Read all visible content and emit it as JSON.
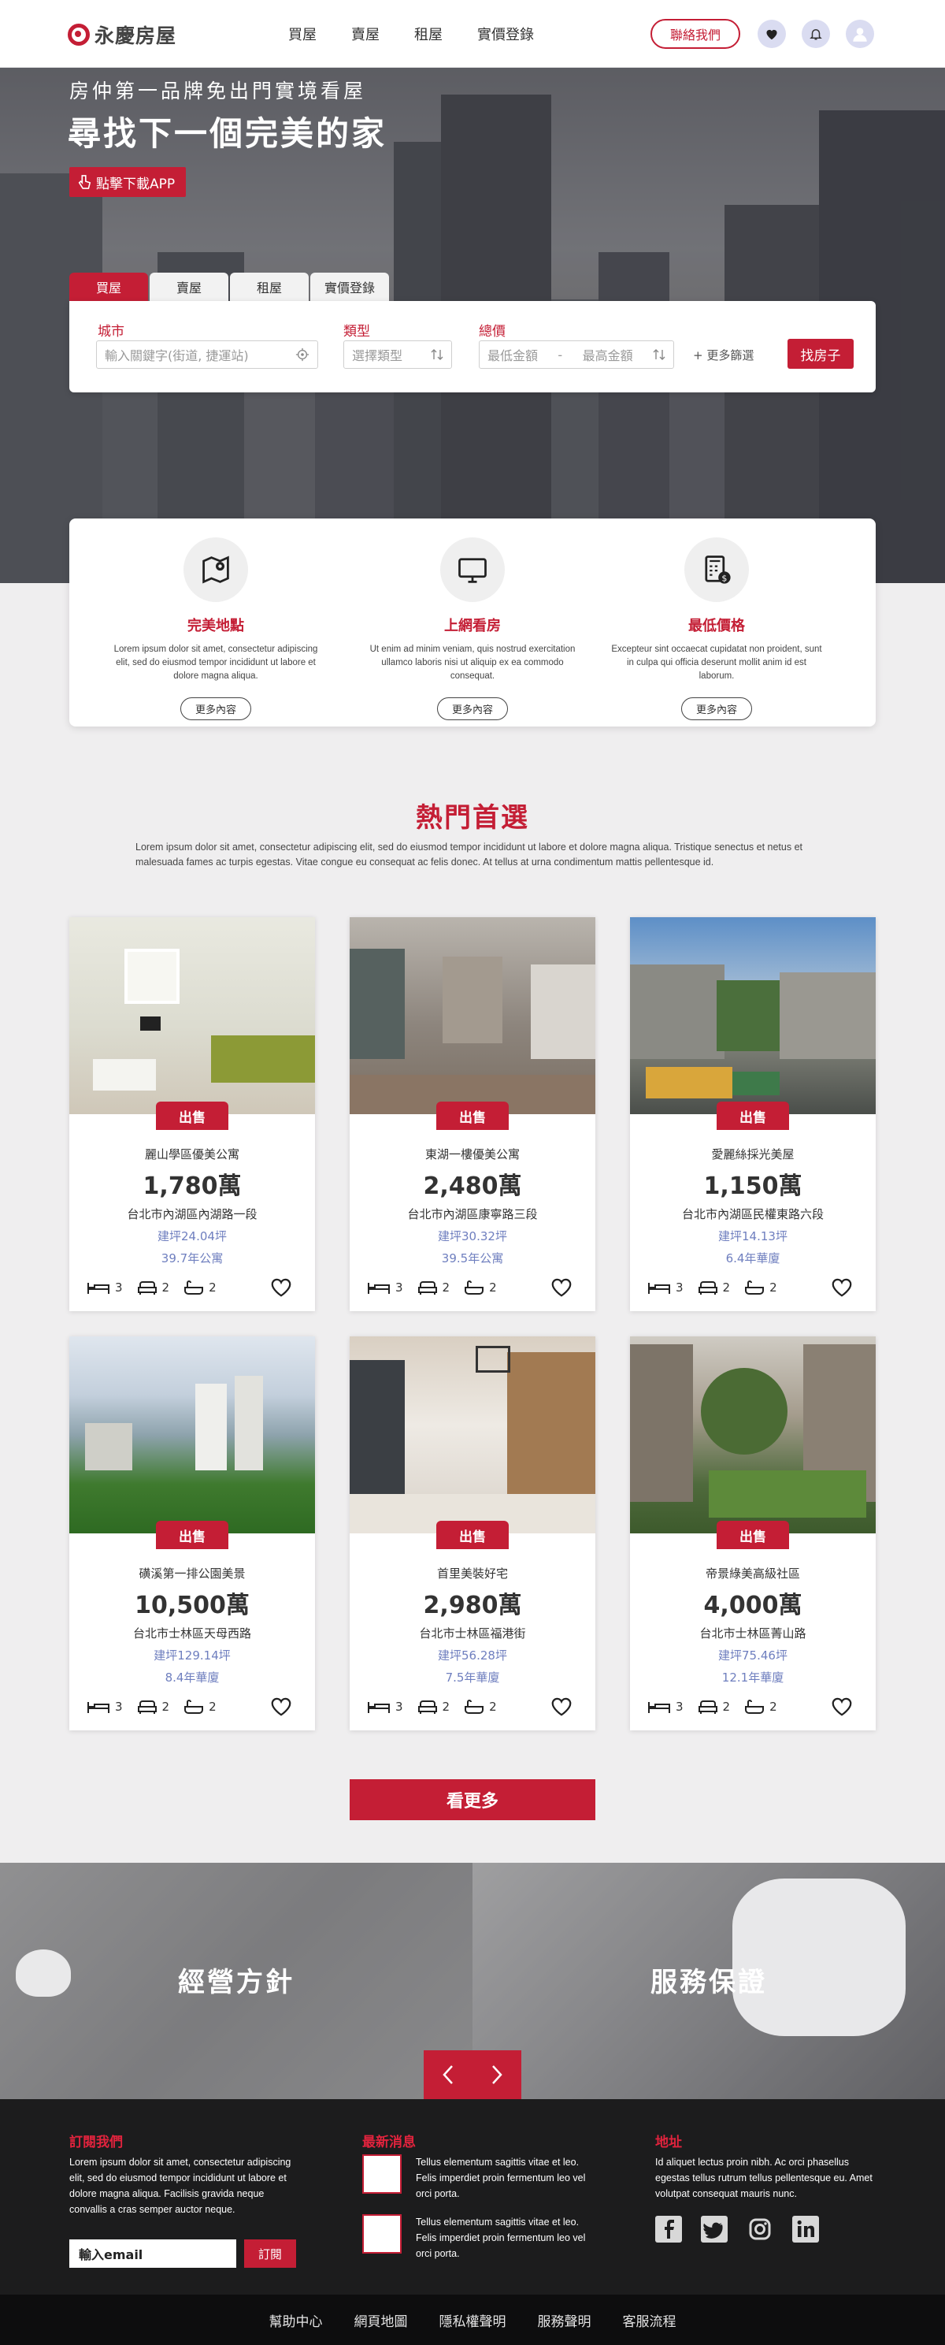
{
  "header": {
    "logo": "永慶房屋",
    "nav": [
      "買屋",
      "賣屋",
      "租屋",
      "實價登錄"
    ],
    "contact": "聯絡我們",
    "icons": [
      "heart-icon",
      "bell-icon",
      "avatar"
    ]
  },
  "hero": {
    "subtitle": "房仲第一品牌免出門實境看屋",
    "title": "尋找下一個完美的家",
    "app_button": "點擊下載APP",
    "tabs": [
      "買屋",
      "賣屋",
      "租屋",
      "實價登錄"
    ],
    "active_tab": "買屋"
  },
  "search": {
    "city_label": "城市",
    "city_placeholder": "輸入關鍵字(街道, 捷運站)",
    "type_label": "類型",
    "type_placeholder": "選擇類型",
    "price_label": "總價",
    "price_min": "最低金額",
    "price_sep": "-",
    "price_max": "最高金額",
    "more_filters": "+ 更多篩選",
    "submit": "找房子"
  },
  "features": [
    {
      "icon": "map-pin-icon",
      "title": "完美地點",
      "desc": "Lorem ipsum dolor sit amet, consectetur adipiscing elit, sed do eiusmod tempor incididunt ut labore et dolore magna aliqua.",
      "button": "更多內容"
    },
    {
      "icon": "monitor-icon",
      "title": "上網看房",
      "desc": "Ut enim ad minim veniam, quis nostrud exercitation ullamco laboris nisi ut aliquip ex ea commodo consequat.",
      "button": "更多內容"
    },
    {
      "icon": "calculator-dollar-icon",
      "title": "最低價格",
      "desc": "Excepteur sint occaecat cupidatat non proident, sunt in culpa qui officia deserunt mollit anim id est laborum.",
      "button": "更多內容"
    }
  ],
  "popular": {
    "title": "熱門首選",
    "desc": "Lorem ipsum dolor sit amet, consectetur adipiscing elit, sed do eiusmod tempor incididunt ut labore et dolore magna aliqua. Tristique senectus et netus et malesuada fames ac turpis egestas. Vitae congue eu consequat ac felis donec. At tellus at urna condimentum mattis pellentesque id.",
    "listings": [
      {
        "badge": "出售",
        "name": "麗山學區優美公寓",
        "price": "1,780萬",
        "address": "台北市內湖區內湖路一段",
        "area": "建坪24.04坪",
        "age": "39.7年公寓",
        "beds": "3",
        "baths": "2",
        "rooms": "2"
      },
      {
        "badge": "出售",
        "name": "東湖一樓優美公寓",
        "price": "2,480萬",
        "address": "台北市內湖區康寧路三段",
        "area": "建坪30.32坪",
        "age": "39.5年公寓",
        "beds": "3",
        "baths": "2",
        "rooms": "2"
      },
      {
        "badge": "出售",
        "name": "愛麗絲採光美屋",
        "price": "1,150萬",
        "address": "台北市內湖區民權東路六段",
        "area": "建坪14.13坪",
        "age": "6.4年華廈",
        "beds": "3",
        "baths": "2",
        "rooms": "2"
      },
      {
        "badge": "出售",
        "name": "磺溪第一排公園美景",
        "price": "10,500萬",
        "address": "台北市士林區天母西路",
        "area": "建坪129.14坪",
        "age": "8.4年華廈",
        "beds": "3",
        "baths": "2",
        "rooms": "2"
      },
      {
        "badge": "出售",
        "name": "首里美裝好宅",
        "price": "2,980萬",
        "address": "台北市士林區福港街",
        "area": "建坪56.28坪",
        "age": "7.5年華廈",
        "beds": "3",
        "baths": "2",
        "rooms": "2"
      },
      {
        "badge": "出售",
        "name": "帝景綠美高級社區",
        "price": "4,000萬",
        "address": "台北市士林區菁山路",
        "area": "建坪75.46坪",
        "age": "12.1年華廈",
        "beds": "3",
        "baths": "2",
        "rooms": "2"
      }
    ],
    "more_button": "看更多"
  },
  "banners": {
    "left": "經營方針",
    "right": "服務保證"
  },
  "footer": {
    "subscribe_title": "訂閱我們",
    "subscribe_text": "Lorem ipsum dolor sit amet, consectetur adipiscing elit, sed do eiusmod tempor incididunt ut labore et dolore magna aliqua. Facilisis gravida neque convallis a cras semper auctor neque.",
    "email_placeholder": "輸入email",
    "subscribe_button": "訂閱",
    "news_title": "最新消息",
    "news": [
      "Tellus elementum sagittis vitae et leo. Felis imperdiet proin fermentum leo vel orci porta.",
      "Tellus elementum sagittis vitae et leo. Felis imperdiet proin fermentum leo vel orci porta."
    ],
    "address_title": "地址",
    "address_text": "Id aliquet lectus proin nibh. Ac orci phasellus egestas tellus rutrum tellus pellentesque eu. Amet volutpat consequat mauris nunc.",
    "social": [
      "facebook-icon",
      "twitter-icon",
      "instagram-icon",
      "linkedin-icon"
    ]
  },
  "bottom_links": [
    "幫助中心",
    "網頁地圖",
    "隱私權聲明",
    "服務聲明",
    "客服流程"
  ],
  "colors": {
    "brand": "#c41e35",
    "link_blue": "#6f7fbf",
    "footer_bg": "#1c1c1d"
  }
}
